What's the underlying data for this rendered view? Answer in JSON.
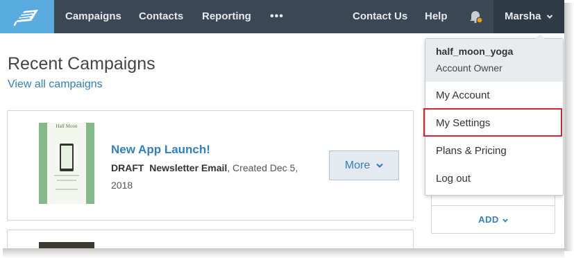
{
  "nav": {
    "items": [
      "Campaigns",
      "Contacts",
      "Reporting"
    ],
    "more": "•••",
    "contact_us": "Contact Us",
    "help": "Help",
    "user_name": "Marsha",
    "notification_dot_color": "#f39c12"
  },
  "main": {
    "title": "Recent Campaigns",
    "view_all": "View all campaigns",
    "campaigns": [
      {
        "thumb_title": "Half Moon",
        "title": "New App Launch!",
        "status": "DRAFT",
        "type": "Newsletter Email",
        "created": ", Created Dec 5, 2018",
        "more_button": "More"
      }
    ]
  },
  "widget": {
    "add_label": "ADD"
  },
  "dropdown": {
    "username": "half_moon_yoga",
    "role": "Account Owner",
    "items": [
      "My Account",
      "My Settings",
      "Plans & Pricing",
      "Log out"
    ],
    "highlighted_item": "My Settings",
    "highlight_color": "#d7262b"
  },
  "colors": {
    "navbar": "#3a4754",
    "logo_bg": "#5aabe0",
    "link": "#2f7fc3"
  }
}
